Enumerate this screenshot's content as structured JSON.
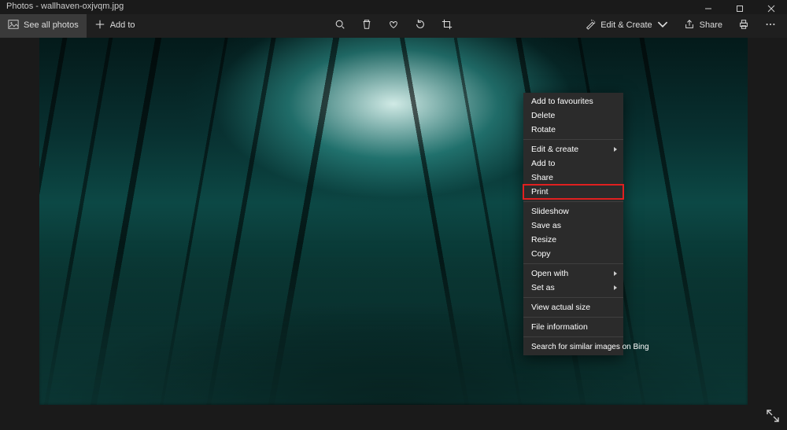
{
  "titlebar": {
    "title": "Photos - wallhaven-oxjvqm.jpg"
  },
  "toolbar": {
    "see_all": "See all photos",
    "add_to": "Add to",
    "edit_create": "Edit & Create",
    "share": "Share"
  },
  "context_menu": {
    "items": [
      {
        "label": "Add to favourites",
        "sub": false
      },
      {
        "label": "Delete",
        "sub": false
      },
      {
        "label": "Rotate",
        "sub": false
      }
    ],
    "items2": [
      {
        "label": "Edit & create",
        "sub": true
      },
      {
        "label": "Add to",
        "sub": false
      },
      {
        "label": "Share",
        "sub": false
      },
      {
        "label": "Print",
        "sub": false,
        "highlight": true
      }
    ],
    "items3": [
      {
        "label": "Slideshow",
        "sub": false
      },
      {
        "label": "Save as",
        "sub": false
      },
      {
        "label": "Resize",
        "sub": false
      },
      {
        "label": "Copy",
        "sub": false
      }
    ],
    "items4": [
      {
        "label": "Open with",
        "sub": true
      },
      {
        "label": "Set as",
        "sub": true
      }
    ],
    "items5": [
      {
        "label": "View actual size",
        "sub": false
      }
    ],
    "items6": [
      {
        "label": "File information",
        "sub": false
      }
    ],
    "items7": [
      {
        "label": "Search for similar images on Bing",
        "sub": false
      }
    ]
  }
}
